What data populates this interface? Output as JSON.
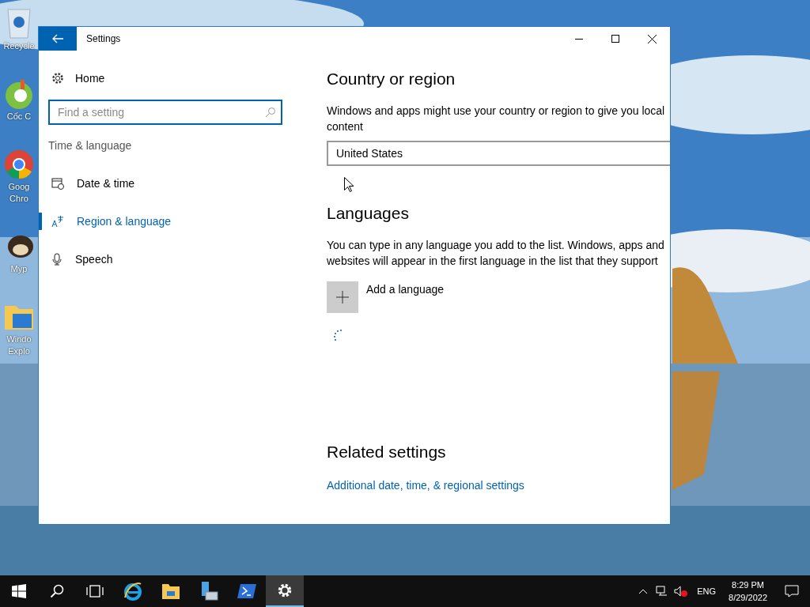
{
  "desktop_icons": [
    {
      "kind": "recycle",
      "label_lines": [
        "Recycle"
      ]
    },
    {
      "kind": "coccoc",
      "label_lines": [
        "Cốc C"
      ]
    },
    {
      "kind": "chrome",
      "label_lines": [
        "Goog",
        "Chro"
      ]
    },
    {
      "kind": "mascot",
      "label_lines": [
        "Myp"
      ]
    },
    {
      "kind": "explorer",
      "label_lines": [
        "Windo",
        "Explo"
      ]
    }
  ],
  "window": {
    "title": "Settings",
    "sidebar": {
      "home": "Home",
      "search": {
        "placeholder": "Find a setting"
      },
      "section": "Time & language",
      "items": [
        {
          "label": "Date & time",
          "selected": false
        },
        {
          "label": "Region & language",
          "selected": true
        },
        {
          "label": "Speech",
          "selected": false
        }
      ]
    },
    "content": {
      "country_heading": "Country or region",
      "country_text": "Windows and apps might use your country or region to give you local content",
      "country_value": "United States",
      "languages_heading": "Languages",
      "languages_text": "You can type in any language you add to the list. Windows, apps and websites will appear in the first language in the list that they support",
      "add_language": "Add a language",
      "related_heading": "Related settings",
      "related_link": "Additional date, time, & regional settings"
    }
  },
  "taskbar": {
    "apps": [
      {
        "kind": "start",
        "selected": false
      },
      {
        "kind": "search",
        "selected": false
      },
      {
        "kind": "taskview",
        "selected": false
      },
      {
        "kind": "ie",
        "selected": false
      },
      {
        "kind": "folder",
        "selected": false
      },
      {
        "kind": "server",
        "selected": false
      },
      {
        "kind": "powershell",
        "selected": false
      },
      {
        "kind": "settings",
        "selected": true
      }
    ],
    "language": "ENG",
    "time": "8:29 PM",
    "date": "8/29/2022"
  }
}
